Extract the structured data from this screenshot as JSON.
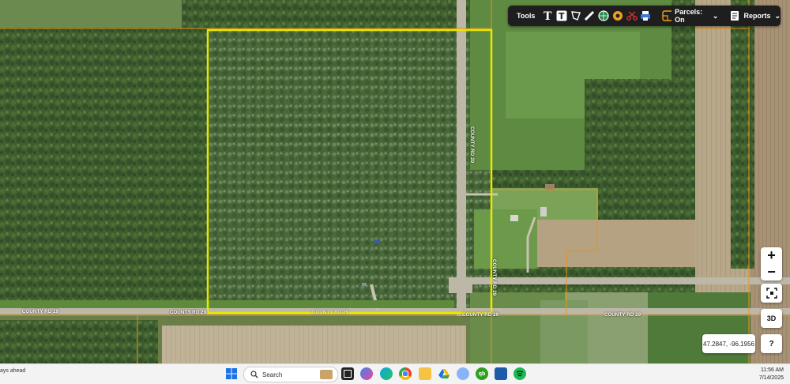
{
  "toolbar": {
    "tools_label": "Tools",
    "parcels_label": "Parcels: On",
    "reports_label": "Reports",
    "colors": {
      "bg": "#1e1e1e",
      "accent_orange": "#f0a020",
      "scissors": "#e03030",
      "printer": "#3a7bd5"
    }
  },
  "map": {
    "road_labels": [
      "COUNTY RD 29",
      "COUNTY RD 29",
      "COUNTY RD 29",
      "COUNTY RD 29",
      "COUNTY RD 29"
    ],
    "vertical_road_labels": [
      "COUNTY RD 29",
      "COUNTY RD 29"
    ],
    "parcel_highlight_color": "#e8e800",
    "parcel_line_color": "#e8941a"
  },
  "controls": {
    "zoom_in": "+",
    "zoom_out": "−",
    "three_d": "3D",
    "help": "?",
    "coordinates": "47.2847, -96.1956"
  },
  "taskbar": {
    "left_text": "ays ahead",
    "search_placeholder": "Search",
    "time": "11:56 AM",
    "date": "7/14/2025"
  }
}
